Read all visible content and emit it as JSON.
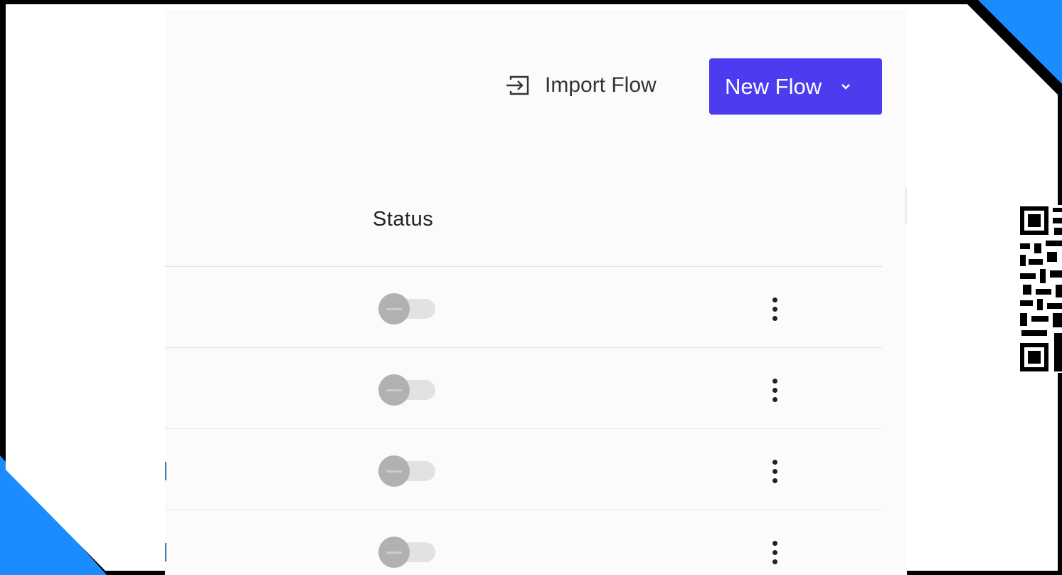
{
  "toolbar": {
    "import_label": "Import Flow",
    "new_flow_label": "New Flow",
    "import_icon": "import-icon",
    "new_flow_icon": "chevron-down-icon"
  },
  "table": {
    "columns": {
      "status": "Status"
    },
    "rows": [
      {
        "status": "off",
        "actions_icon": "more-vertical-icon"
      },
      {
        "status": "off",
        "actions_icon": "more-vertical-icon"
      },
      {
        "status": "off",
        "actions_icon": "more-vertical-icon"
      },
      {
        "status": "off",
        "actions_icon": "more-vertical-icon"
      }
    ]
  },
  "colors": {
    "primary": "#4b3cf0",
    "frame_accent": "#1a8cff",
    "toggle_knob": "#b1b1b1",
    "toggle_track": "#e2e2e2"
  }
}
